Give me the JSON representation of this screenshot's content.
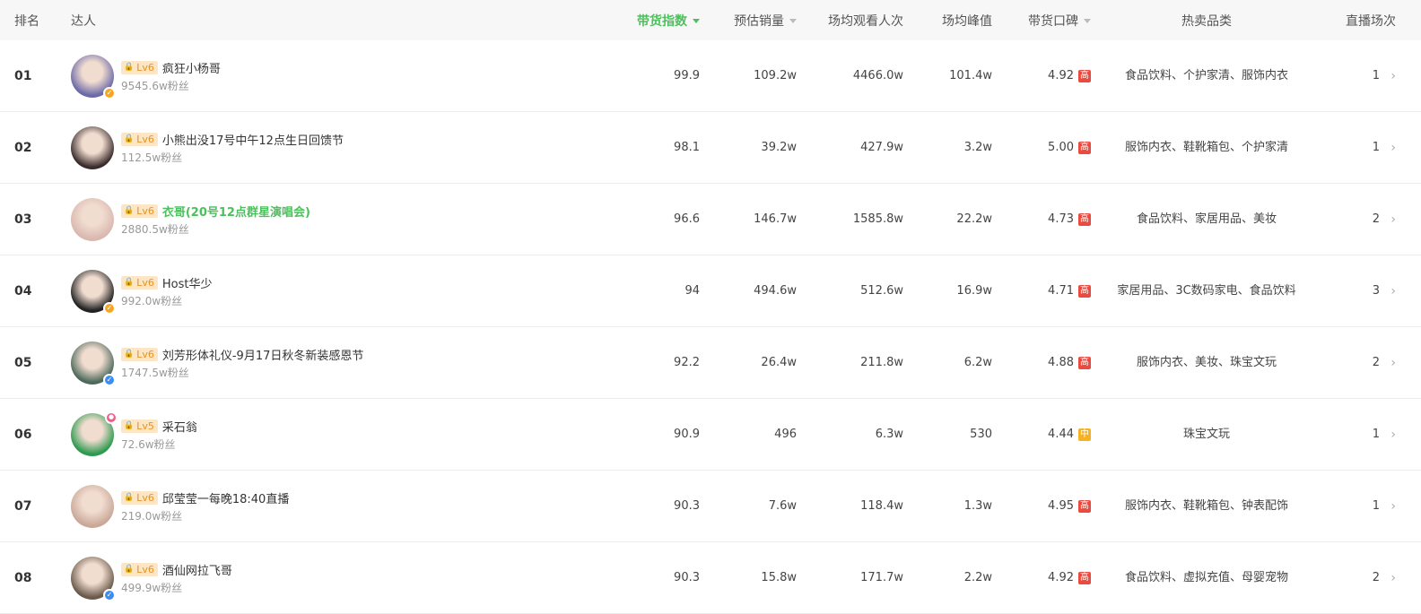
{
  "header": {
    "rank": "排名",
    "talent": "达人",
    "index": "带货指数",
    "sales": "预估销量",
    "avg_view": "场均观看人次",
    "avg_peak": "场均峰值",
    "reputation": "带货口碑",
    "hot_category": "热卖品类",
    "sessions": "直播场次"
  },
  "colors": {
    "accent_green": "#4cc05c",
    "tag_high": "#e84b42",
    "tag_mid": "#f5b324",
    "level_bg": "#fde6c4",
    "level_text": "#e9912b"
  },
  "rows": [
    {
      "rank": "01",
      "level": "Lv6",
      "name": "疯狂小杨哥",
      "fans": "9545.6w粉丝",
      "index": "99.9",
      "sales": "109.2w",
      "avg_view": "4466.0w",
      "avg_peak": "101.4w",
      "score": "4.92",
      "score_tag": "高",
      "category": "食品饮料、个护家清、服饰内衣",
      "sessions": "1",
      "badge": "orange",
      "avatar_color": "#6b6aa8"
    },
    {
      "rank": "02",
      "level": "Lv6",
      "name": "小熊出没17号中午12点生日回馈节",
      "fans": "112.5w粉丝",
      "index": "98.1",
      "sales": "39.2w",
      "avg_view": "427.9w",
      "avg_peak": "3.2w",
      "score": "5.00",
      "score_tag": "高",
      "category": "服饰内衣、鞋靴箱包、个护家清",
      "sessions": "1",
      "badge": "none",
      "avatar_color": "#3a2c2c"
    },
    {
      "rank": "03",
      "level": "Lv6",
      "name": "衣哥(20号12点群星演唱会)",
      "fans": "2880.5w粉丝",
      "index": "96.6",
      "sales": "146.7w",
      "avg_view": "1585.8w",
      "avg_peak": "22.2w",
      "score": "4.73",
      "score_tag": "高",
      "category": "食品饮料、家居用品、美妆",
      "sessions": "2",
      "badge": "none",
      "avatar_color": "#d9b8b0"
    },
    {
      "rank": "04",
      "level": "Lv6",
      "name": "Host华少",
      "fans": "992.0w粉丝",
      "index": "94",
      "sales": "494.6w",
      "avg_view": "512.6w",
      "avg_peak": "16.9w",
      "score": "4.71",
      "score_tag": "高",
      "category": "家居用品、3C数码家电、食品饮料",
      "sessions": "3",
      "badge": "orange",
      "avatar_color": "#222222"
    },
    {
      "rank": "05",
      "level": "Lv6",
      "name": "刘芳形体礼仪-9月17日秋冬新装感恩节",
      "fans": "1747.5w粉丝",
      "index": "92.2",
      "sales": "26.4w",
      "avg_view": "211.8w",
      "avg_peak": "6.2w",
      "score": "4.88",
      "score_tag": "高",
      "category": "服饰内衣、美妆、珠宝文玩",
      "sessions": "2",
      "badge": "blue",
      "avatar_color": "#4c6a5a"
    },
    {
      "rank": "06",
      "level": "Lv5",
      "name": "采石翁",
      "fans": "72.6w粉丝",
      "index": "90.9",
      "sales": "496",
      "avg_view": "6.3w",
      "avg_peak": "530",
      "score": "4.44",
      "score_tag": "中",
      "category": "珠宝文玩",
      "sessions": "1",
      "badge": "pink",
      "avatar_color": "#2e9a4e"
    },
    {
      "rank": "07",
      "level": "Lv6",
      "name": "邱莹莹一每晚18:40直播",
      "fans": "219.0w粉丝",
      "index": "90.3",
      "sales": "7.6w",
      "avg_view": "118.4w",
      "avg_peak": "1.3w",
      "score": "4.95",
      "score_tag": "高",
      "category": "服饰内衣、鞋靴箱包、钟表配饰",
      "sessions": "1",
      "badge": "none",
      "avatar_color": "#c9a898"
    },
    {
      "rank": "08",
      "level": "Lv6",
      "name": "酒仙网拉飞哥",
      "fans": "499.9w粉丝",
      "index": "90.3",
      "sales": "15.8w",
      "avg_view": "171.7w",
      "avg_peak": "2.2w",
      "score": "4.92",
      "score_tag": "高",
      "category": "食品饮料、虚拟充值、母婴宠物",
      "sessions": "2",
      "badge": "blue",
      "avatar_color": "#6a5a4a"
    }
  ]
}
